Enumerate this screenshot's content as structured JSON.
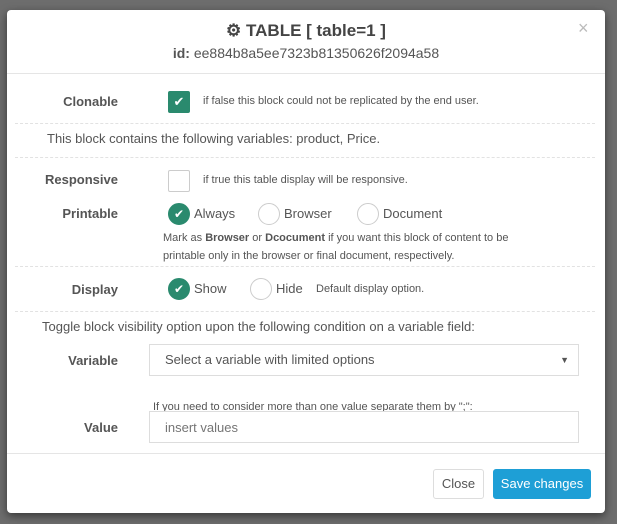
{
  "modal": {
    "title": "TABLE [ table=1 ]",
    "title_icon": "gear-icon",
    "id_label": "id:",
    "id_value": "ee884b8a5ee7323b81350626f2094a58",
    "close_symbol": "×",
    "clonable": {
      "label": "Clonable",
      "checked": true,
      "help": "if false this block could not be replicated by the end user."
    },
    "variables_text": "This block contains the following variables: product, Price.",
    "responsive": {
      "label": "Responsive",
      "checked": false,
      "help": "if true this table display will be responsive."
    },
    "printable": {
      "label": "Printable",
      "options": [
        "Always",
        "Browser",
        "Document"
      ],
      "selected": "Always",
      "help_parts": [
        "Mark as ",
        "Browser",
        " or ",
        "Dcocument",
        " if you want this block of content to be printable only in the browser or final document, respectively."
      ]
    },
    "display": {
      "label": "Display",
      "options": [
        "Show",
        "Hide"
      ],
      "selected": "Show",
      "help": "Default display option."
    },
    "toggle_text": "Toggle block visibility option upon the following condition on a variable field:",
    "variable": {
      "label": "Variable",
      "selected": "Select a variable with limited options"
    },
    "value_help": "If you need to consider more than one value separate them by \";\":",
    "value": {
      "label": "Value",
      "placeholder": "insert values",
      "value": ""
    },
    "buttons": {
      "close": "Close",
      "save": "Save changes"
    },
    "colors": {
      "accent": "#2a8a6e",
      "primary": "#1e9fd6"
    }
  }
}
